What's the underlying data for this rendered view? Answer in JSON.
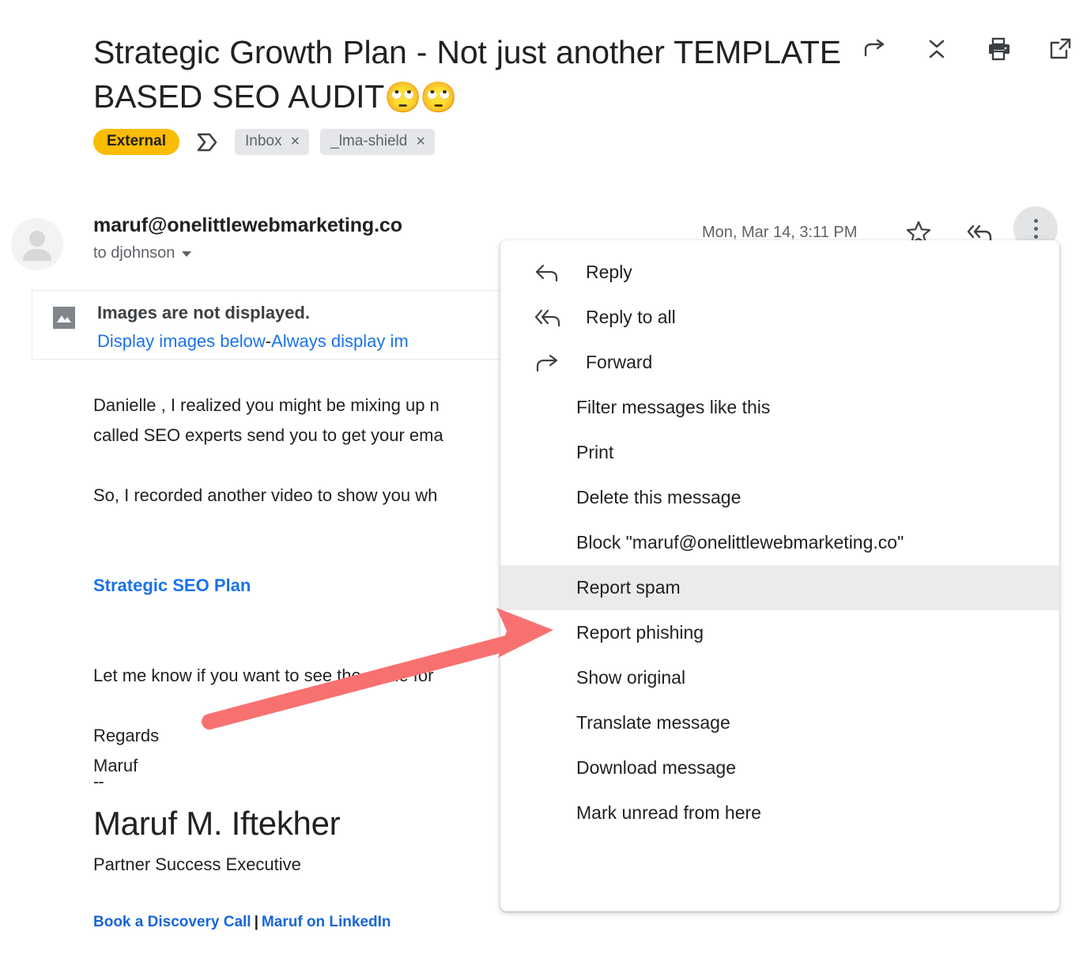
{
  "email": {
    "subject": "Strategic Growth Plan - Not just another TEMPLATE BASED SEO AUDIT",
    "subject_emoji": "🙄🙄",
    "labels": {
      "external_badge": "External",
      "inbox_tab_icon": "inbox-tab-icon",
      "chips": [
        {
          "name": "Inbox",
          "remove": "×"
        },
        {
          "name": "_lma-shield",
          "remove": "×"
        }
      ]
    },
    "header_actions": [
      {
        "icon": "forward-icon",
        "name": "forward-button"
      },
      {
        "icon": "collapse-icon",
        "name": "collapse-all-button"
      },
      {
        "icon": "print-icon",
        "name": "print-button"
      },
      {
        "icon": "open-in-new-icon",
        "name": "open-in-new-window-button"
      }
    ],
    "sender": "maruf@onelittlewebmarketing.co",
    "recipient": "to djohnson",
    "date": "Mon, Mar 14, 3:11 PM",
    "avatar_icon": "person-avatar-icon",
    "star_icon": "star-icon",
    "reply_all_icon": "reply-all-icon",
    "more_icon": "more-vert-icon"
  },
  "images_banner": {
    "icon": "broken-image-icon",
    "title": "Images are not displayed.",
    "display_link": "Display images below",
    "separator": "-",
    "always_link": "Always display im"
  },
  "body": {
    "line1": "Danielle , I realized you might be mixing up n",
    "line2": "called SEO experts send you to get your ema",
    "line3": "So, I recorded another video to show you wh",
    "seo_plan_link": "Strategic SEO Plan",
    "line4": "Let me know if you want to see the same for",
    "regards": "Regards",
    "signoff_name": "Maruf"
  },
  "signature": {
    "dashes": "--",
    "name": "Maruf M. Iftekher",
    "title": "Partner Success Executive",
    "link_call": "Book a Discovery Call",
    "pipe": "|",
    "link_linkedin": "Maruf on LinkedIn"
  },
  "context_menu": {
    "items": [
      {
        "label": "Reply",
        "icon": "reply-icon",
        "highlight": false
      },
      {
        "label": "Reply to all",
        "icon": "reply-all-icon",
        "highlight": false
      },
      {
        "label": "Forward",
        "icon": "forward-icon",
        "highlight": false
      },
      {
        "label": "Filter messages like this",
        "icon": null,
        "highlight": false
      },
      {
        "label": "Print",
        "icon": null,
        "highlight": false
      },
      {
        "label": "Delete this message",
        "icon": null,
        "highlight": false
      },
      {
        "label": "Block \"maruf@onelittlewebmarketing.co\"",
        "icon": null,
        "highlight": false
      },
      {
        "label": "Report spam",
        "icon": null,
        "highlight": true
      },
      {
        "label": "Report phishing",
        "icon": null,
        "highlight": false
      },
      {
        "label": "Show original",
        "icon": null,
        "highlight": false
      },
      {
        "label": "Translate message",
        "icon": null,
        "highlight": false
      },
      {
        "label": "Download message",
        "icon": null,
        "highlight": false
      },
      {
        "label": "Mark unread from here",
        "icon": null,
        "highlight": false
      }
    ]
  },
  "annotation": {
    "arrow_color": "#F87171",
    "points_to": "Report spam"
  },
  "colors": {
    "external_badge": "#FBBC04",
    "link_blue": "#1a73e8",
    "chip_gray": "#e4e6e9",
    "menu_highlight": "#ebebeb",
    "arrow": "#F87171"
  }
}
